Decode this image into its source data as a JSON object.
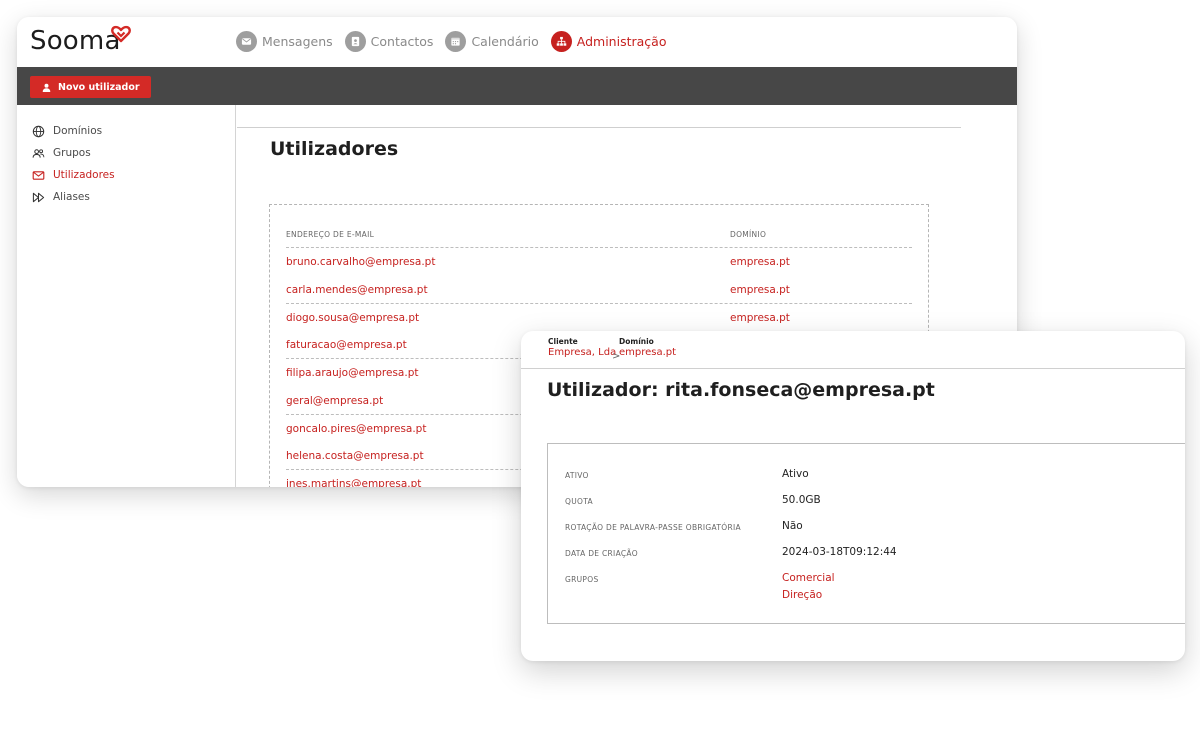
{
  "app": {
    "logo_text": "Sooma",
    "nav": [
      {
        "label": "Mensagens",
        "icon": "envelope-icon"
      },
      {
        "label": "Contactos",
        "icon": "contact-card-icon"
      },
      {
        "label": "Calendário",
        "icon": "calendar-icon"
      },
      {
        "label": "Administração",
        "icon": "org-chart-icon",
        "active": true
      }
    ],
    "toolbar": {
      "new_user_label": "Novo utilizador"
    },
    "sidebar": [
      {
        "label": "Domínios",
        "icon": "globe-icon"
      },
      {
        "label": "Grupos",
        "icon": "group-icon"
      },
      {
        "label": "Utilizadores",
        "icon": "envelope-icon",
        "active": true
      },
      {
        "label": "Aliases",
        "icon": "fast-forward-icon"
      }
    ],
    "colors": {
      "accent": "#c6211f",
      "toolbar_bg": "#474747",
      "inactive_icon": "#9e9e9e"
    }
  },
  "users_page": {
    "title": "Utilizadores",
    "columns": {
      "email": "Endereço de e-mail",
      "domain": "Domínio"
    },
    "rows": [
      {
        "email": "bruno.carvalho@empresa.pt",
        "domain": "empresa.pt"
      },
      {
        "email": "carla.mendes@empresa.pt",
        "domain": "empresa.pt"
      },
      {
        "email": "diogo.sousa@empresa.pt",
        "domain": "empresa.pt"
      },
      {
        "email": "faturacao@empresa.pt",
        "domain": ""
      },
      {
        "email": "filipa.araujo@empresa.pt",
        "domain": ""
      },
      {
        "email": "geral@empresa.pt",
        "domain": ""
      },
      {
        "email": "goncalo.pires@empresa.pt",
        "domain": ""
      },
      {
        "email": "helena.costa@empresa.pt",
        "domain": ""
      },
      {
        "email": "ines.martins@empresa.pt",
        "domain": ""
      }
    ]
  },
  "user_detail": {
    "breadcrumb": {
      "client_label": "Cliente",
      "client_value": "Empresa, Lda",
      "separator": ">",
      "domain_label": "Domínio",
      "domain_value": "empresa.pt"
    },
    "title": "Utilizador: rita.fonseca@empresa.pt",
    "fields": {
      "status": {
        "label": "Ativo",
        "value": "Ativo"
      },
      "quota": {
        "label": "Quota",
        "value": "50.0GB"
      },
      "password_rotation": {
        "label": "Rotação de palavra-passe obrigatória",
        "value": "Não"
      },
      "created": {
        "label": "Data de criação",
        "value": "2024-03-18T09:12:44"
      },
      "groups": {
        "label": "Grupos",
        "values": [
          "Comercial",
          "Direção"
        ]
      }
    }
  }
}
